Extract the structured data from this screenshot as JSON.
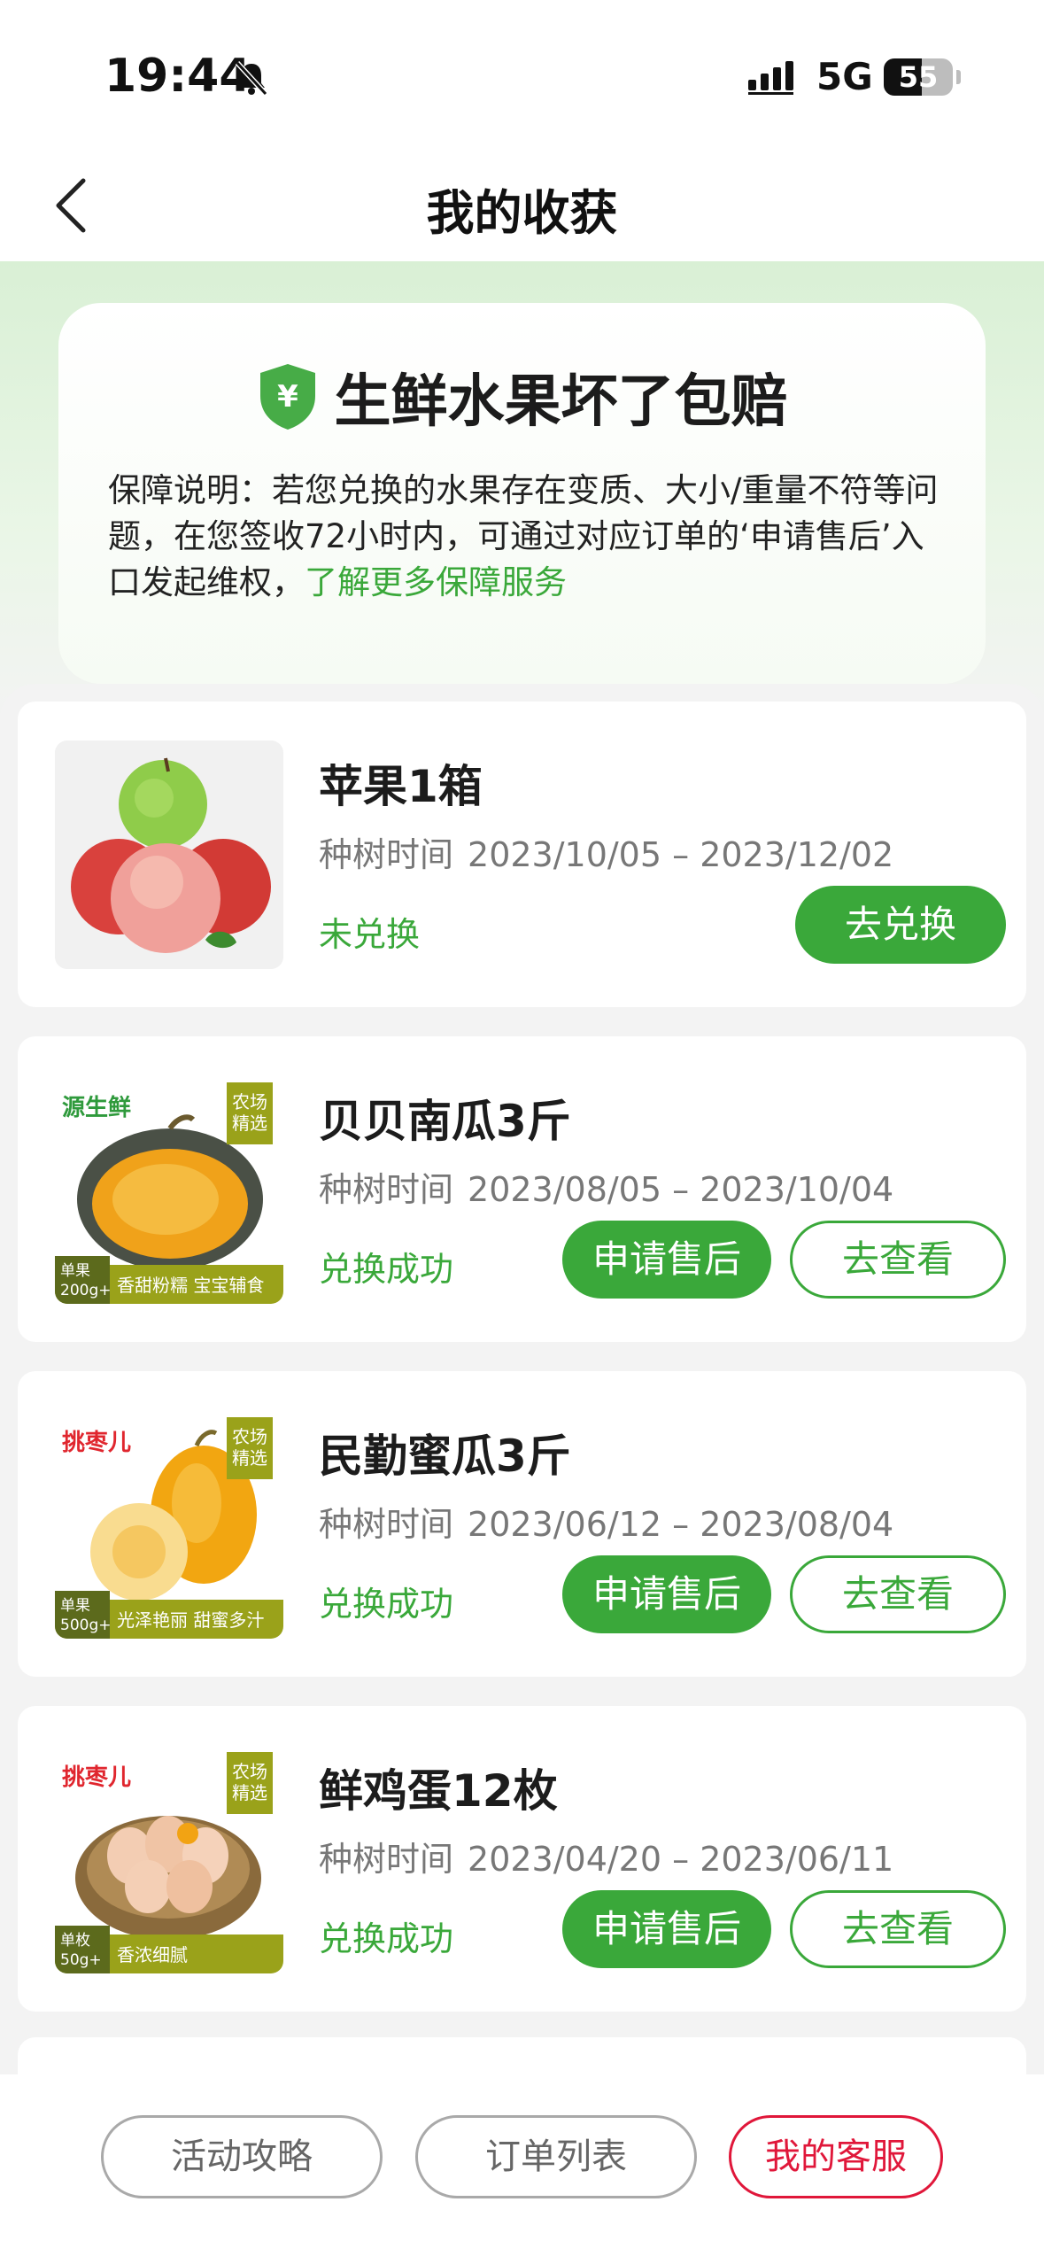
{
  "status_bar": {
    "time": "19:44",
    "network": "5G",
    "battery": "55",
    "battery_level_percent": 55
  },
  "header": {
    "title": "我的收获"
  },
  "guarantee": {
    "title": "生鲜水果坏了包赔",
    "shield_symbol": "¥",
    "description": "保障说明：若您兑换的水果存在变质、大小/重量不符等问题，在您签收72小时内，可通过对应订单的‘申请售后’入口发起维权，",
    "link": "了解更多保障服务"
  },
  "items": [
    {
      "name": "苹果1箱",
      "period_label": "种树时间",
      "period": "2023/10/05 – 2023/12/02",
      "status": "未兑换",
      "primary_button": "去兑换"
    },
    {
      "name": "贝贝南瓜3斤",
      "period_label": "种树时间",
      "period": "2023/08/05 – 2023/10/04",
      "status": "兑换成功",
      "primary_button": "申请售后",
      "secondary_button": "去查看",
      "image_brand": "源生鲜",
      "image_badge": "农场精选",
      "image_foot_left": "单果200g+",
      "image_foot_text": "香甜粉糯 宝宝辅食"
    },
    {
      "name": "民勤蜜瓜3斤",
      "period_label": "种树时间",
      "period": "2023/06/12 – 2023/08/04",
      "status": "兑换成功",
      "primary_button": "申请售后",
      "secondary_button": "去查看",
      "image_brand": "挑枣儿",
      "image_badge": "农场精选",
      "image_foot_left": "单果500g+",
      "image_foot_text": "光泽艳丽 甜蜜多汁"
    },
    {
      "name": "鲜鸡蛋12枚",
      "period_label": "种树时间",
      "period": "2023/04/20 – 2023/06/11",
      "status": "兑换成功",
      "primary_button": "申请售后",
      "secondary_button": "去查看",
      "image_brand": "挑枣儿",
      "image_badge": "农场精选",
      "image_foot_left": "单枚50g+",
      "image_foot_text": "香浓细腻"
    }
  ],
  "bottom_bar": {
    "guide": "活动攻略",
    "orders": "订单列表",
    "service": "我的客服"
  },
  "colors": {
    "accent_green": "#3aa83a",
    "service_red": "#e0173a"
  }
}
